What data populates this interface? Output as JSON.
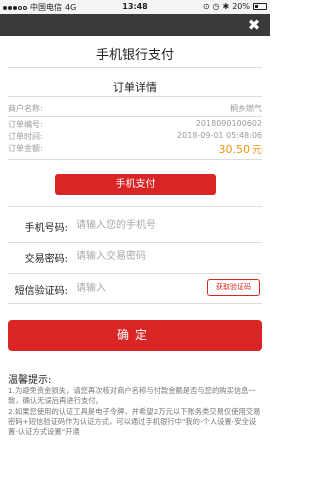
{
  "status_bar": {
    "carrier": "中国电信",
    "network": "4G",
    "time": "13:48",
    "battery": "20%"
  },
  "header": {
    "close_glyph": "✖",
    "title": "手机银行支付"
  },
  "order": {
    "section_title": "订单详情",
    "rows": [
      {
        "label": "商户名称:",
        "value": "桐乡燃气"
      },
      {
        "label": "订单编号:",
        "value": "2018090100602"
      },
      {
        "label": "订单时间:",
        "value": "2018-09-01 05:48:06"
      },
      {
        "label": "订单金额:",
        "value": "30.50",
        "unit": "元"
      }
    ],
    "amount_color": "#f0961a"
  },
  "pay_button": {
    "label": "手机支付"
  },
  "form": {
    "phone": {
      "label": "手机号码:",
      "placeholder": "请输入您的手机号"
    },
    "password": {
      "label": "交易密码:",
      "placeholder": "请输入交易密码"
    },
    "sms": {
      "label": "短信验证码:",
      "placeholder": "请输入",
      "button_label": "获取验证码"
    }
  },
  "confirm_button": {
    "label": "确定"
  },
  "tips": {
    "title": "温馨提示:",
    "line1": "1.为避免资金损失，请您再次核对商户名称与付款金额是否与您的购买信息一致，确认无误后再进行支付。",
    "line2": "2.如果您使用的认证工具是电子令牌，并希望2万元以下账务类交易仅使用交易密码+短信验证码作为认证方式，可以通过手机银行中\"我的-个人设置-安全设置-认证方式设置\"开通"
  },
  "colors": {
    "brand_red": "#d92524",
    "top_bar": "#3a3a3a"
  }
}
